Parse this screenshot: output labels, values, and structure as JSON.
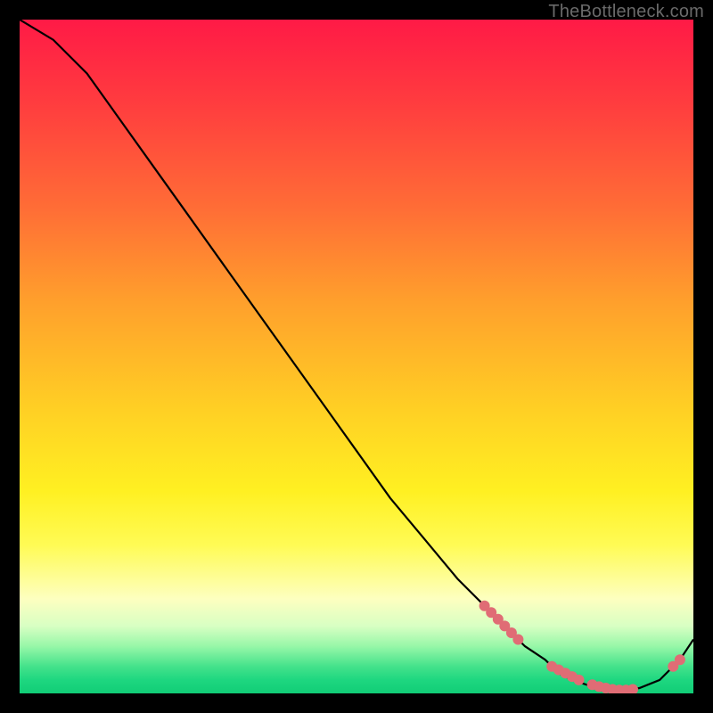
{
  "watermark": "TheBottleneck.com",
  "chart_data": {
    "type": "line",
    "title": "",
    "xlabel": "",
    "ylabel": "",
    "xlim": [
      0,
      100
    ],
    "ylim": [
      0,
      100
    ],
    "series": [
      {
        "name": "curve",
        "x": [
          0,
          5,
          10,
          15,
          20,
          25,
          30,
          35,
          40,
          45,
          50,
          55,
          60,
          65,
          70,
          72,
          75,
          78,
          80,
          82,
          85,
          88,
          90,
          92,
          95,
          98,
          100
        ],
        "y": [
          100,
          97,
          92,
          85,
          78,
          71,
          64,
          57,
          50,
          43,
          36,
          29,
          23,
          17,
          12,
          10,
          7,
          5,
          3,
          2,
          1,
          0.5,
          0.5,
          0.8,
          2,
          5,
          8
        ]
      }
    ],
    "markers": [
      {
        "x": 69,
        "y": 13
      },
      {
        "x": 70,
        "y": 12
      },
      {
        "x": 71,
        "y": 11
      },
      {
        "x": 72,
        "y": 10
      },
      {
        "x": 73,
        "y": 9
      },
      {
        "x": 74,
        "y": 8
      },
      {
        "x": 79,
        "y": 4
      },
      {
        "x": 80,
        "y": 3.5
      },
      {
        "x": 81,
        "y": 3
      },
      {
        "x": 82,
        "y": 2.5
      },
      {
        "x": 83,
        "y": 2
      },
      {
        "x": 85,
        "y": 1.3
      },
      {
        "x": 86,
        "y": 1
      },
      {
        "x": 87,
        "y": 0.8
      },
      {
        "x": 88,
        "y": 0.6
      },
      {
        "x": 89,
        "y": 0.5
      },
      {
        "x": 90,
        "y": 0.5
      },
      {
        "x": 91,
        "y": 0.6
      },
      {
        "x": 97,
        "y": 4
      },
      {
        "x": 98,
        "y": 5
      }
    ],
    "marker_style": {
      "color": "#e06c75",
      "radius_px": 6
    }
  }
}
